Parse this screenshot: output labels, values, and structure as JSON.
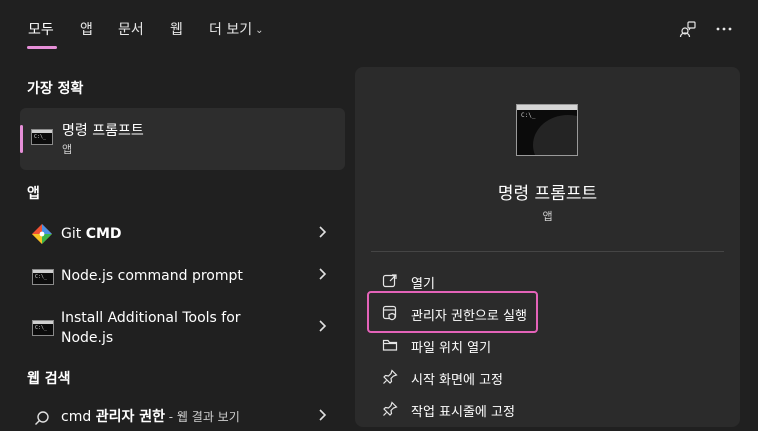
{
  "tabs": [
    {
      "label": "모두"
    },
    {
      "label": "앱"
    },
    {
      "label": "문서"
    },
    {
      "label": "웹"
    },
    {
      "label": "더 보기"
    }
  ],
  "more_chevron": "⌄",
  "top_icons": {
    "share": "people-icon",
    "more": "more-options-icon"
  },
  "sections": {
    "best": "가장 정확",
    "apps": "앱",
    "web": "웹 검색"
  },
  "best_match": {
    "name": "명령 프롬프트",
    "type": "앱",
    "icon": "command-prompt-icon"
  },
  "apps": [
    {
      "prefix": "Git ",
      "bold": "CMD",
      "icon": "git-icon"
    },
    {
      "label": "Node.js command prompt",
      "icon": "command-prompt-icon"
    },
    {
      "label_line1": "Install Additional Tools for",
      "label_line2": "Node.js",
      "icon": "command-prompt-icon"
    }
  ],
  "web_search": {
    "query": "cmd",
    "bold": "관리자 권한",
    "suffix": " - 웹 결과 보기",
    "icon": "search-icon"
  },
  "detail": {
    "title": "명령 프롬프트",
    "subtitle": "앱",
    "actions": [
      {
        "label": "열기",
        "icon": "open-external-icon"
      },
      {
        "label": "관리자 권한으로 실행",
        "icon": "shield-admin-icon"
      },
      {
        "label": "파일 위치 열기",
        "icon": "folder-icon"
      },
      {
        "label": "시작 화면에 고정",
        "icon": "pin-icon"
      },
      {
        "label": "작업 표시줄에 고정",
        "icon": "pin-icon"
      }
    ]
  },
  "colors": {
    "accent": "#e68fd8",
    "highlight_box": "#e463b9",
    "background": "#202020",
    "panel": "#2b2b2b"
  }
}
